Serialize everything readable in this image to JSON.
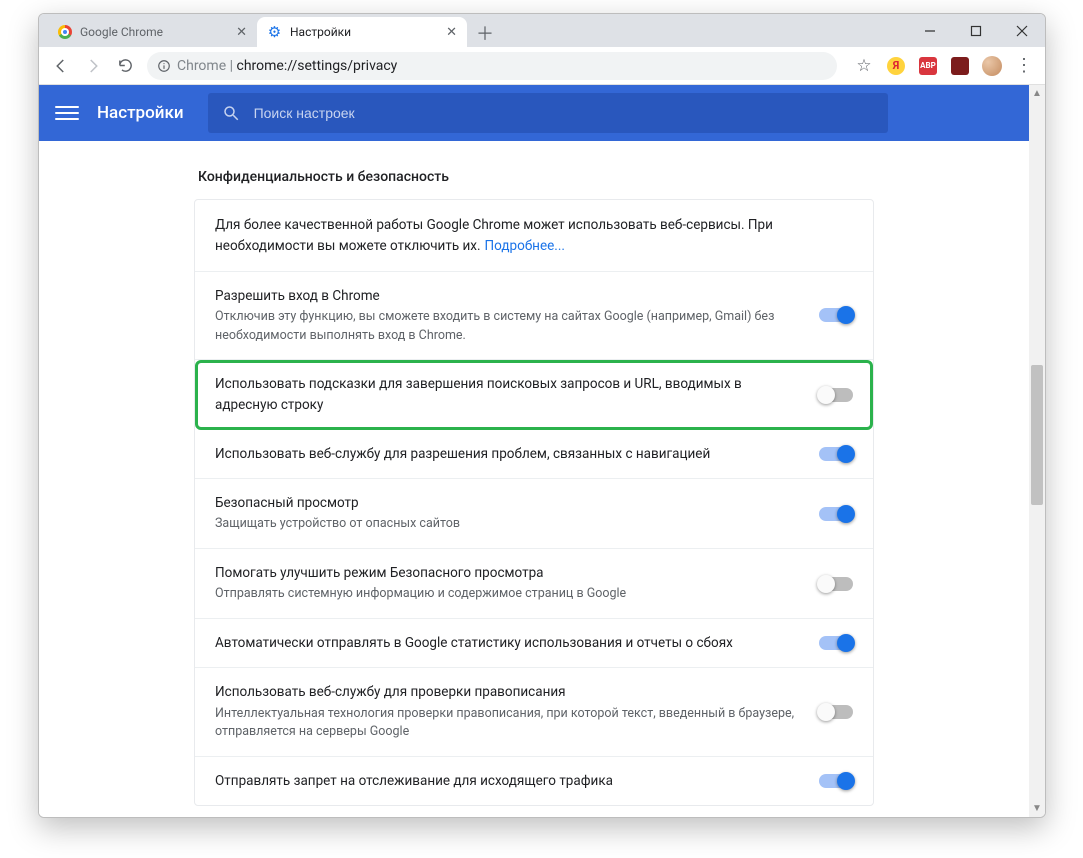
{
  "tabs": [
    {
      "label": "Google Chrome",
      "active": false
    },
    {
      "label": "Настройки",
      "active": true
    }
  ],
  "url": {
    "scheme": "Chrome",
    "full": "chrome://settings/privacy"
  },
  "yandex_letter": "Я",
  "abp_label": "ABP",
  "header": {
    "title": "Настройки",
    "search_placeholder": "Поиск настроек"
  },
  "section_title": "Конфиденциальность и безопасность",
  "intro": {
    "text": "Для более качественной работы Google Chrome может использовать веб-сервисы. При необходимости вы можете отключить их.",
    "link": "Подробнее..."
  },
  "rows": [
    {
      "title": "Разрешить вход в Chrome",
      "sub": "Отключив эту функцию, вы сможете входить в систему на сайтах Google (например, Gmail) без необходимости выполнять вход в Chrome.",
      "on": true,
      "highlight": false
    },
    {
      "title": "Использовать подсказки для завершения поисковых запросов и URL, вводимых в адресную строку",
      "sub": "",
      "on": false,
      "highlight": true
    },
    {
      "title": "Использовать веб-службу для разрешения проблем, связанных с навигацией",
      "sub": "",
      "on": true,
      "highlight": false
    },
    {
      "title": "Безопасный просмотр",
      "sub": "Защищать устройство от опасных сайтов",
      "on": true,
      "highlight": false
    },
    {
      "title": "Помогать улучшить режим Безопасного просмотра",
      "sub": "Отправлять системную информацию и содержимое страниц в Google",
      "on": false,
      "highlight": false
    },
    {
      "title": "Автоматически отправлять в Google статистику использования и отчеты о сбоях",
      "sub": "",
      "on": true,
      "highlight": false
    },
    {
      "title": "Использовать веб-службу для проверки правописания",
      "sub": "Интеллектуальная технология проверки правописания, при которой текст, введенный в браузере, отправляется на серверы Google",
      "on": false,
      "highlight": false
    },
    {
      "title": "Отправлять запрет на отслеживание для исходящего трафика",
      "sub": "",
      "on": true,
      "highlight": false
    }
  ]
}
